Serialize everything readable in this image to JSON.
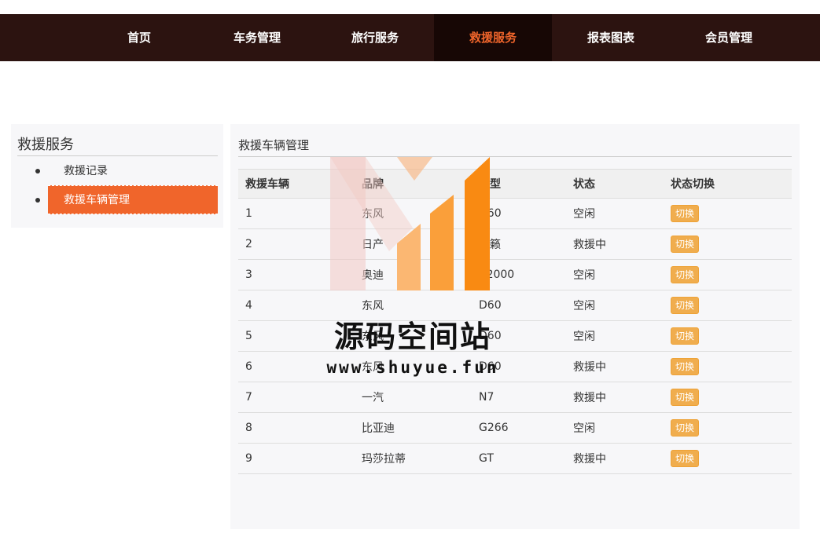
{
  "nav": {
    "items": [
      {
        "label": "首页"
      },
      {
        "label": "车务管理"
      },
      {
        "label": "旅行服务"
      },
      {
        "label": "救援服务"
      },
      {
        "label": "报表图表"
      },
      {
        "label": "会员管理"
      }
    ],
    "active_index": 3
  },
  "sidebar": {
    "title": "救援服务",
    "items": [
      {
        "label": "救援记录"
      },
      {
        "label": "救援车辆管理"
      }
    ],
    "active_index": 1
  },
  "main": {
    "title": "救援车辆管理",
    "table": {
      "headers": [
        "救援车辆",
        "品牌",
        "车型",
        "状态",
        "状态切换"
      ],
      "rows": [
        {
          "id": "1",
          "brand": "东风",
          "model": "D60",
          "status": "空闲",
          "action": "切换"
        },
        {
          "id": "2",
          "brand": "日产",
          "model": "天籁",
          "status": "救援中",
          "action": "切换"
        },
        {
          "id": "3",
          "brand": "奥迪",
          "model": "A2000",
          "status": "空闲",
          "action": "切换"
        },
        {
          "id": "4",
          "brand": "东风",
          "model": "D60",
          "status": "空闲",
          "action": "切换"
        },
        {
          "id": "5",
          "brand": "东风",
          "model": "D60",
          "status": "空闲",
          "action": "切换"
        },
        {
          "id": "6",
          "brand": "东风",
          "model": "D60",
          "status": "救援中",
          "action": "切换"
        },
        {
          "id": "7",
          "brand": "一汽",
          "model": "N7",
          "status": "救援中",
          "action": "切换"
        },
        {
          "id": "8",
          "brand": "比亚迪",
          "model": "G266",
          "status": "空闲",
          "action": "切换"
        },
        {
          "id": "9",
          "brand": "玛莎拉蒂",
          "model": "GT",
          "status": "救援中",
          "action": "切换"
        }
      ]
    }
  },
  "watermark": {
    "name": "源码空间站",
    "url": "www.shuyue.fun"
  },
  "colors": {
    "nav_bg": "#2c1310",
    "nav_active_bg": "#170705",
    "accent": "#f0652b",
    "button": "#f0ad4e"
  }
}
